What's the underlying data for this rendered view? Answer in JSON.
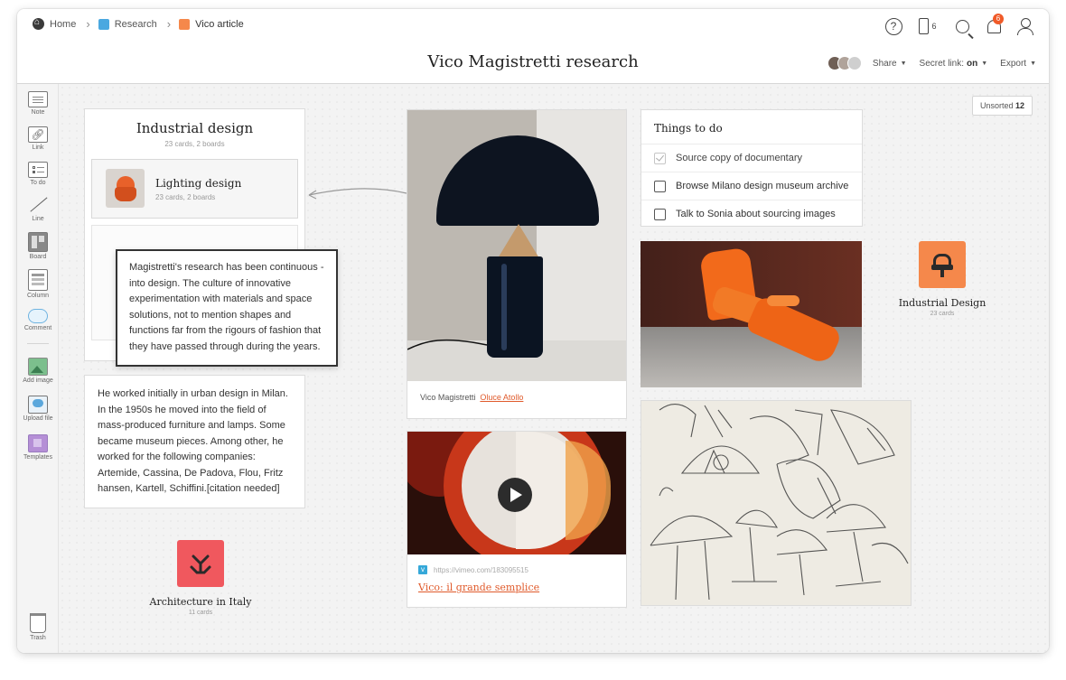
{
  "breadcrumb": [
    {
      "label": "Home",
      "icon": "home-icon",
      "color": "#3a3a3a"
    },
    {
      "label": "Research",
      "icon": "board-square-icon",
      "color": "#4aa8e0"
    },
    {
      "label": "Vico article",
      "icon": "board-square-icon",
      "color": "#f5884b"
    }
  ],
  "header": {
    "title": "Vico Magistretti research",
    "phone_count": "6",
    "notification_count": "6",
    "share_label": "Share",
    "secret_link_label": "Secret link:",
    "secret_link_value": "on",
    "export_label": "Export"
  },
  "sidebar": {
    "tools": [
      {
        "label": "Note",
        "icon": "note-icon"
      },
      {
        "label": "Link",
        "icon": "link-icon"
      },
      {
        "label": "To do",
        "icon": "todo-icon"
      },
      {
        "label": "Line",
        "icon": "line-icon"
      },
      {
        "label": "Board",
        "icon": "board-icon"
      },
      {
        "label": "Column",
        "icon": "column-icon"
      },
      {
        "label": "Comment",
        "icon": "comment-icon"
      },
      {
        "label": "Add image",
        "icon": "add-image-icon"
      },
      {
        "label": "Upload file",
        "icon": "upload-icon"
      },
      {
        "label": "Templates",
        "icon": "templates-icon"
      }
    ],
    "trash_label": "Trash"
  },
  "canvas": {
    "unsorted_label": "Unsorted",
    "unsorted_count": "12",
    "column": {
      "title": "Industrial design",
      "subtitle": "23 cards, 2 boards",
      "board_title": "Lighting design",
      "board_subtitle": "23 cards, 2 boards"
    },
    "floating_note": "Magistretti's research has been continuous - into design. The culture of innovative experimentation with materials and space solutions, not to mention shapes and functions far from the rigours of fashion that they have passed through during the years.",
    "bio_note": "He worked initially in urban design in Milan. In the 1950s he moved into the field of mass-produced furniture and lamps. Some became museum pieces. Among other, he worked for the following companies: Artemide, Cassina, De Padova, Flou, Fritz hansen, Kartell, Schiffini.[citation needed]",
    "arch_board": {
      "title": "Architecture in Italy",
      "subtitle": "11 cards",
      "color": "#f0585e"
    },
    "lamp_card": {
      "caption_prefix": "Vico Magistretti",
      "caption_link": "Oluce Atollo"
    },
    "video_card": {
      "url": "https://vimeo.com/183095515",
      "title": "Vico: il grande semplice"
    },
    "todo": {
      "title": "Things to do",
      "items": [
        {
          "label": "Source copy of documentary",
          "done": true
        },
        {
          "label": "Browse Milano design museum archive",
          "done": false
        },
        {
          "label": "Talk to Sonia about sourcing images",
          "done": false
        }
      ]
    },
    "industrial_board": {
      "title": "Industrial Design",
      "subtitle": "23 cards",
      "color": "#f5884b"
    }
  },
  "colors": {
    "accent": "#e05a2b",
    "canvas_bg": "#f3f3f3"
  }
}
